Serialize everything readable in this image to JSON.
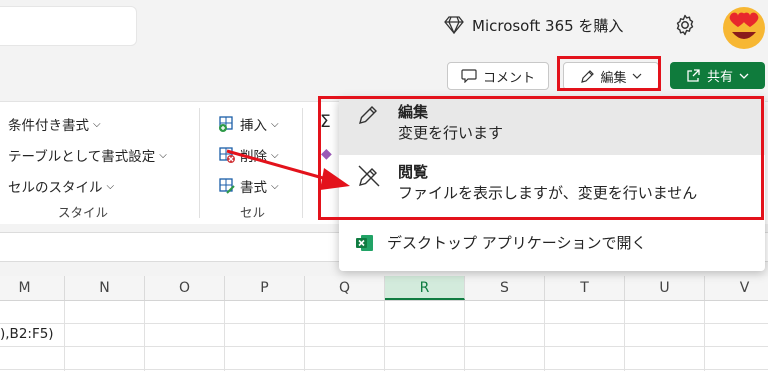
{
  "header": {
    "ms365_label": "Microsoft 365 を購入"
  },
  "toolbar": {
    "comment_label": "コメント",
    "edit_label": "編集",
    "share_label": "共有"
  },
  "ribbon": {
    "style_items": [
      "条件付き書式",
      "テーブルとして書式設定",
      "セルのスタイル"
    ],
    "style_group": "スタイル",
    "cell_items": [
      "挿入",
      "削除",
      "書式"
    ],
    "cell_group": "セル"
  },
  "grid": {
    "columns": [
      "M",
      "N",
      "O",
      "P",
      "Q",
      "R",
      "S",
      "T",
      "U",
      "V"
    ],
    "selected_column": "R",
    "cell_text": "),B2:F5)"
  },
  "menu": {
    "edit_title": "編集",
    "edit_desc": "変更を行います",
    "view_title": "閲覧",
    "view_desc": "ファイルを表示しますが、変更を行いません",
    "desktop_label": "デスクトップ アプリケーションで開く"
  },
  "colors": {
    "highlight": "#e3121b",
    "share_bg": "#0f7b3c",
    "selected_col": "#d3ebdc"
  }
}
